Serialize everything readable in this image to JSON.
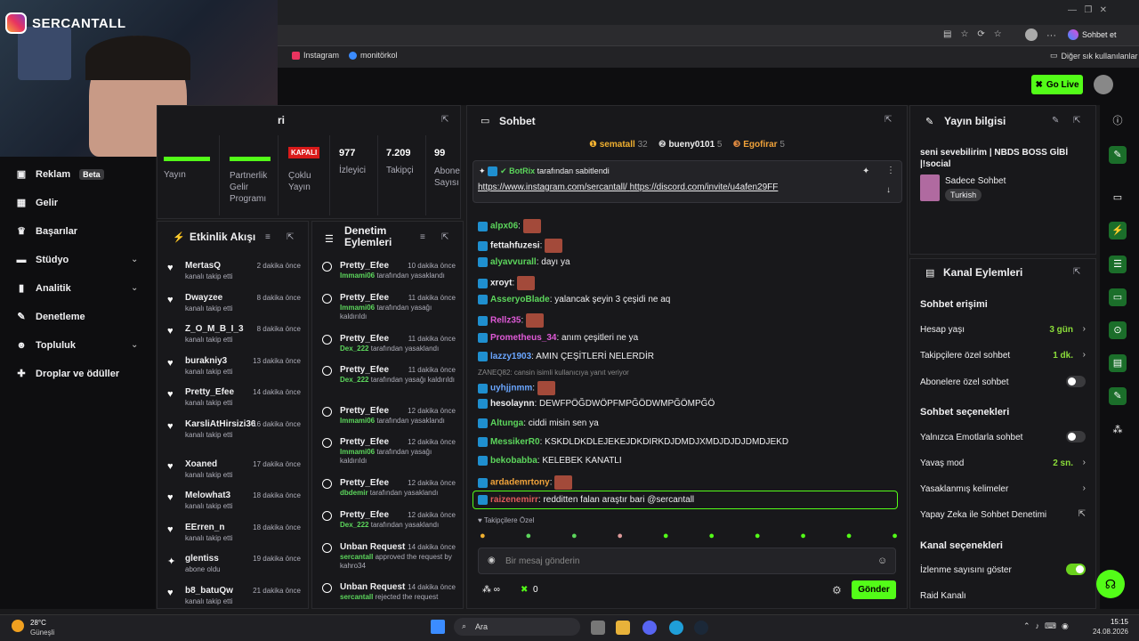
{
  "browser": {
    "bookmarks": [
      "Instagram",
      "monitörkol"
    ],
    "other_bookmarks": "Diğer sık kullanılanlar",
    "chat_label": "Sohbet et"
  },
  "webcam": {
    "channel": "SERCANTALL"
  },
  "nav": {
    "items": [
      {
        "label": "Reklam",
        "badge": "Beta"
      },
      {
        "label": "Gelir"
      },
      {
        "label": "Başarılar"
      },
      {
        "label": "Stüdyo"
      },
      {
        "label": "Analitik"
      },
      {
        "label": "Denetleme"
      },
      {
        "label": "Topluluk"
      },
      {
        "label": "Droplar ve ödüller"
      }
    ]
  },
  "header": {
    "go_live": "Go Live"
  },
  "stats": {
    "title_suffix": "ri",
    "yayin": "Yayın",
    "partner": "Partnerlik Gelir Programı",
    "kapali": "KAPALI",
    "coklu": "Çoklu Yayın",
    "izleyici_num": "977",
    "izleyici": "İzleyici",
    "takipci_num": "7.209",
    "takipci": "Takipçi",
    "abone_num": "99",
    "abone": "Abone Sayısı"
  },
  "activity": {
    "title": "Etkinlik Akışı",
    "rows": [
      {
        "name": "MertasQ",
        "sub": "kanalı takip etti",
        "time": "2 dakika önce"
      },
      {
        "name": "Dwayzee",
        "sub": "kanalı takip etti",
        "time": "8 dakika önce"
      },
      {
        "name": "Z_O_M_B_I_3",
        "sub": "kanalı takip etti",
        "time": "8 dakika önce"
      },
      {
        "name": "burakniy3",
        "sub": "kanalı takip etti",
        "time": "13 dakika önce"
      },
      {
        "name": "Pretty_Efee",
        "sub": "kanalı takip etti",
        "time": "14 dakika önce"
      },
      {
        "name": "KarsliAtHirsizi36",
        "sub": "kanalı takip etti",
        "time": "16 dakika önce"
      },
      {
        "name": "Xoaned",
        "sub": "kanalı takip etti",
        "time": "17 dakika önce"
      },
      {
        "name": "Melowhat3",
        "sub": "kanalı takip etti",
        "time": "18 dakika önce"
      },
      {
        "name": "EErren_n",
        "sub": "kanalı takip etti",
        "time": "18 dakika önce"
      },
      {
        "name": "glentiss",
        "sub": "abone oldu",
        "time": "19 dakika önce"
      },
      {
        "name": "b8_batuQw",
        "sub": "kanalı takip etti",
        "time": "21 dakika önce"
      }
    ]
  },
  "moderation": {
    "title": "Denetim Eylemleri",
    "rows": [
      {
        "name": "Pretty_Efee",
        "by": "Immami06",
        "action": "tarafından yasaklandı",
        "time": "10 dakika önce"
      },
      {
        "name": "Pretty_Efee",
        "by": "Immami06",
        "action": "tarafından yasağı kaldırıldı",
        "time": "11 dakika önce"
      },
      {
        "name": "Pretty_Efee",
        "by": "Dex_222",
        "action": "tarafından yasaklandı",
        "time": "11 dakika önce"
      },
      {
        "name": "Pretty_Efee",
        "by": "Dex_222",
        "action": "tarafından yasağı kaldırıldı",
        "time": "11 dakika önce"
      },
      {
        "name": "Pretty_Efee",
        "by": "Immami06",
        "action": "tarafından yasaklandı",
        "time": "12 dakika önce"
      },
      {
        "name": "Pretty_Efee",
        "by": "Immami06",
        "action": "tarafından yasağı kaldırıldı",
        "time": "12 dakika önce"
      },
      {
        "name": "Pretty_Efee",
        "by": "dbdemir",
        "action": "tarafından yasaklandı",
        "time": "12 dakika önce"
      },
      {
        "name": "Pretty_Efee",
        "by": "Dex_222",
        "action": "tarafından yasaklandı",
        "time": "12 dakika önce"
      },
      {
        "name": "Unban Request",
        "by": "sercantall",
        "action": "approved the request by kahro34",
        "time": "14 dakika önce"
      },
      {
        "name": "Unban Request",
        "by": "sercantall",
        "action": "rejected the request",
        "time": "14 dakika önce"
      }
    ]
  },
  "chat": {
    "title": "Sohbet",
    "top": [
      {
        "name": "sematall",
        "count": "32"
      },
      {
        "name": "bueny0101",
        "count": "5"
      },
      {
        "name": "Egofirar",
        "count": "5"
      }
    ],
    "pinned_by": "BotRix",
    "pinned_suffix": "tarafından sabitlendi",
    "pinned_link1": "https://www.instagram.com/sercantall/",
    "pinned_link2": "https://discord.com/invite/u4afen29FF",
    "messages": [
      {
        "user": "alpx06",
        "text": ":",
        "color": "#5cd65c"
      },
      {
        "user": "fettahfuzesi",
        "text": ":",
        "color": "#efeff1"
      },
      {
        "user": "alyavvurall",
        "text": ": dayı ya",
        "color": "#5cd65c"
      },
      {
        "user": "xroyt",
        "text": ":",
        "color": "#efeff1"
      },
      {
        "user": "AsseryoBlade",
        "text": ": yalancak şeyin 3 çeşidi ne aq",
        "color": "#5cd65c"
      },
      {
        "user": "Rellz35",
        "text": ":",
        "color": "#e05ad8"
      },
      {
        "user": "Prometheus_34",
        "text": ": anım çeşitleri ne ya",
        "color": "#e05ad8"
      },
      {
        "user": "lazzy1903",
        "text": ": AMIN ÇEŞİTLERİ NELERDİR",
        "color": "#6aa6ff"
      },
      {
        "user": "uyhjjnmm",
        "text": ":",
        "color": "#6aa6ff"
      },
      {
        "user": "hesolaynn",
        "text": ": DEWFPÖĞDWÖPFMPĞÖDWMPĞÖMPĞÖ",
        "color": "#efeff1"
      },
      {
        "user": "Altunga",
        "text": ": ciddi misin sen ya",
        "color": "#5cd65c"
      },
      {
        "user": "MessikerR0",
        "text": ": KSKDLDKDLEJEKEJDKDIRKDJDMDJXMDJDJDJDMDJEKD",
        "color": "#5cd65c"
      },
      {
        "user": "bekobabba",
        "text": ": KELEBEK KANATLI",
        "color": "#5cd65c"
      },
      {
        "user": "ardademrtony",
        "text": ":",
        "color": "#f0a23a"
      },
      {
        "user": "raizenemirr",
        "text": ": redditten falan araştır bari @sercantall",
        "color": "#e05a5a"
      }
    ],
    "reply_hint": "ZANEQ82: cansin isimli kullanıcıya yanıt veriyor",
    "followers_only": "Takipçilere Özel",
    "placeholder": "Bir mesaj gönderin",
    "points": "∞",
    "coins": "0",
    "send": "Gönder"
  },
  "streaminfo": {
    "title": "Yayın bilgisi",
    "stream_title": "seni sevebilirim | NBDS BOSS GİBİ |!social",
    "category": "Sadece Sohbet",
    "tag": "Turkish"
  },
  "channel": {
    "title": "Kanal Eylemleri",
    "access_title": "Sohbet erişimi",
    "account_age": "Hesap yaşı",
    "account_age_val": "3 gün",
    "followers_chat": "Takipçilere özel sohbet",
    "followers_chat_val": "1 dk.",
    "subs_chat": "Abonelere özel sohbet",
    "options_title": "Sohbet seçenekleri",
    "emote_only": "Yalnızca Emotlarla sohbet",
    "slow_mode": "Yavaş mod",
    "slow_mode_val": "2 sn.",
    "banned_words": "Yasaklanmış kelimeler",
    "ai_mod": "Yapay Zeka ile Sohbet Denetimi",
    "channel_opts": "Kanal seçenekleri",
    "show_viewers": "İzlenme sayısını göster",
    "raid": "Raid Kanalı"
  },
  "taskbar": {
    "temp": "28°C",
    "weather": "Güneşli",
    "search": "Ara",
    "time": "15:15",
    "date": "24.08.2026"
  }
}
